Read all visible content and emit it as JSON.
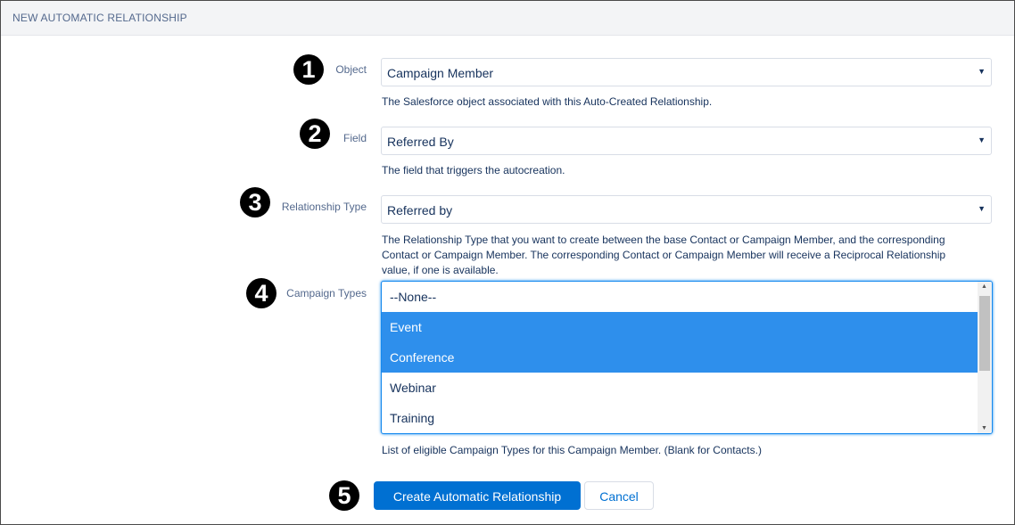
{
  "header": {
    "title": "NEW AUTOMATIC RELATIONSHIP"
  },
  "markers": [
    "1",
    "2",
    "3",
    "4",
    "5"
  ],
  "fields": {
    "object": {
      "label": "Object",
      "value": "Campaign Member",
      "help": "The Salesforce object associated with this Auto-Created Relationship."
    },
    "field": {
      "label": "Field",
      "value": "Referred By",
      "help": "The field that triggers the autocreation."
    },
    "relationship_type": {
      "label": "Relationship Type",
      "value": "Referred by",
      "help_line1": "The Relationship Type that you want to create between the base Contact or Campaign Member, and the corresponding",
      "help_line2": "Contact or Campaign Member. The corresponding Contact or Campaign Member will receive a Reciprocal Relationship",
      "help_line3": "value, if one is available."
    },
    "campaign_types": {
      "label": "Campaign Types",
      "options": [
        {
          "label": "--None--",
          "selected": false
        },
        {
          "label": "Event",
          "selected": true
        },
        {
          "label": "Conference",
          "selected": true
        },
        {
          "label": "Webinar",
          "selected": false
        },
        {
          "label": "Training",
          "selected": false
        }
      ],
      "help": "List of eligible Campaign Types for this Campaign Member. (Blank for Contacts.)"
    }
  },
  "actions": {
    "create_label": "Create Automatic Relationship",
    "cancel_label": "Cancel"
  },
  "colors": {
    "primary": "#0070d2",
    "selected_option": "#2e8fec",
    "label_text": "#54698d",
    "body_text": "#16325c"
  }
}
